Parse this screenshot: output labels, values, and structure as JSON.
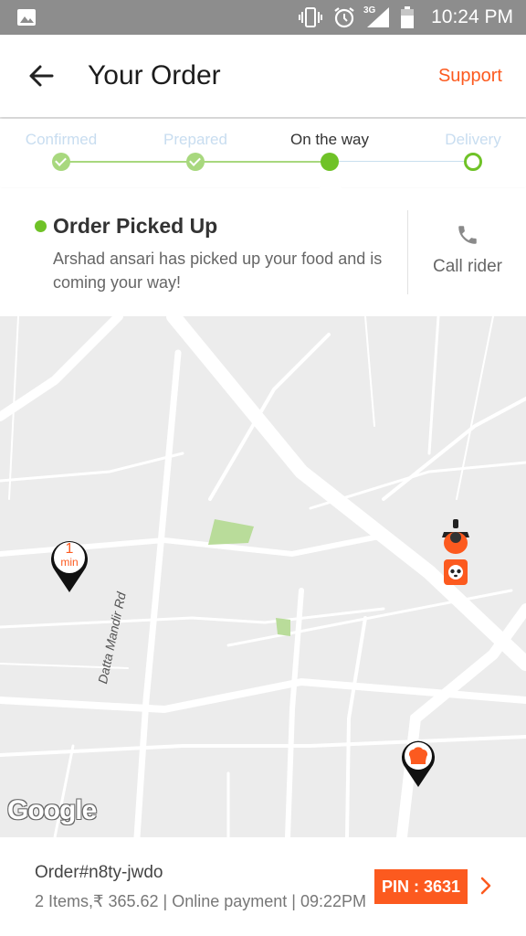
{
  "status_bar": {
    "time": "10:24 PM",
    "network": "3G"
  },
  "header": {
    "title": "Your Order",
    "support_label": "Support",
    "accent_color": "#fc5a1f"
  },
  "progress": {
    "steps": [
      {
        "label": "Confirmed",
        "state": "done"
      },
      {
        "label": "Prepared",
        "state": "done"
      },
      {
        "label": "On the way",
        "state": "current"
      },
      {
        "label": "Delivery",
        "state": "pending"
      }
    ],
    "active_color": "#6fc227"
  },
  "status_card": {
    "title": "Order Picked Up",
    "message": "Arshad ansari has picked up your food and is coming your way!",
    "call_label": "Call rider"
  },
  "map": {
    "eta_value": "1",
    "eta_unit": "min",
    "road_label": "Datta Mandir Rd",
    "attribution": "Google",
    "markers": [
      "eta-pin",
      "rider-scooter",
      "restaurant-pin"
    ]
  },
  "footer": {
    "order_id": "Order#n8ty-jwdo",
    "meta": "2 Items,₹ 365.62 | Online payment | 09:22PM",
    "pin": "PIN : 3631"
  }
}
